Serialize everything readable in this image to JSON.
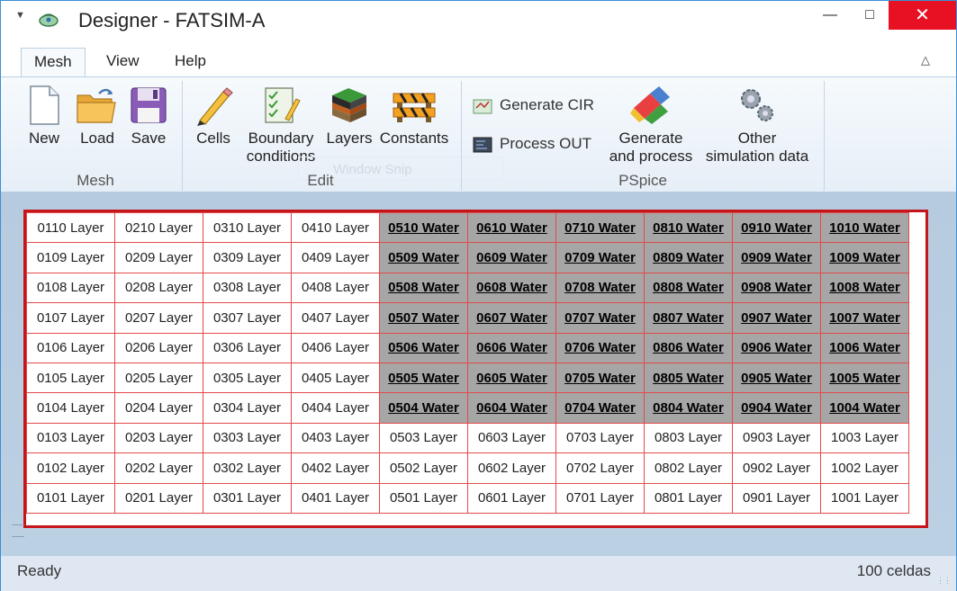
{
  "window": {
    "title": "Designer - FATSIM-A"
  },
  "tabs": [
    {
      "label": "Mesh",
      "active": true
    },
    {
      "label": "View",
      "active": false
    },
    {
      "label": "Help",
      "active": false
    }
  ],
  "ribbon": {
    "groups": {
      "mesh": "Mesh",
      "edit": "Edit",
      "pspice": "PSpice"
    },
    "buttons": {
      "new": "New",
      "load": "Load",
      "save": "Save",
      "cells": "Cells",
      "boundary_l1": "Boundary",
      "boundary_l2": "conditions",
      "layers": "Layers",
      "constants": "Constants",
      "generate_cir": "Generate CIR",
      "process_out": "Process OUT",
      "generate_l1": "Generate",
      "generate_l2": "and process",
      "other_l1": "Other",
      "other_l2": "simulation data"
    },
    "ghost_label": "Window Snip"
  },
  "mesh": {
    "rows": [
      [
        "0110 Layer",
        "0210 Layer",
        "0310 Layer",
        "0410 Layer",
        "0510 Water",
        "0610 Water",
        "0710 Water",
        "0810 Water",
        "0910 Water",
        "1010 Water"
      ],
      [
        "0109 Layer",
        "0209 Layer",
        "0309 Layer",
        "0409 Layer",
        "0509 Water",
        "0609 Water",
        "0709 Water",
        "0809 Water",
        "0909 Water",
        "1009 Water"
      ],
      [
        "0108 Layer",
        "0208 Layer",
        "0308 Layer",
        "0408 Layer",
        "0508 Water",
        "0608 Water",
        "0708 Water",
        "0808 Water",
        "0908 Water",
        "1008 Water"
      ],
      [
        "0107 Layer",
        "0207 Layer",
        "0307 Layer",
        "0407 Layer",
        "0507 Water",
        "0607 Water",
        "0707 Water",
        "0807 Water",
        "0907 Water",
        "1007 Water"
      ],
      [
        "0106 Layer",
        "0206 Layer",
        "0306 Layer",
        "0406 Layer",
        "0506 Water",
        "0606 Water",
        "0706 Water",
        "0806 Water",
        "0906 Water",
        "1006 Water"
      ],
      [
        "0105 Layer",
        "0205 Layer",
        "0305 Layer",
        "0405 Layer",
        "0505 Water",
        "0605 Water",
        "0705 Water",
        "0805 Water",
        "0905 Water",
        "1005 Water"
      ],
      [
        "0104 Layer",
        "0204 Layer",
        "0304 Layer",
        "0404 Layer",
        "0504 Water",
        "0604 Water",
        "0704 Water",
        "0804 Water",
        "0904 Water",
        "1004 Water"
      ],
      [
        "0103 Layer",
        "0203 Layer",
        "0303 Layer",
        "0403 Layer",
        "0503 Layer",
        "0603 Layer",
        "0703 Layer",
        "0803 Layer",
        "0903 Layer",
        "1003 Layer"
      ],
      [
        "0102 Layer",
        "0202 Layer",
        "0302 Layer",
        "0402 Layer",
        "0502 Layer",
        "0602 Layer",
        "0702 Layer",
        "0802 Layer",
        "0902 Layer",
        "1002 Layer"
      ],
      [
        "0101 Layer",
        "0201 Layer",
        "0301 Layer",
        "0401 Layer",
        "0501 Layer",
        "0601 Layer",
        "0701 Layer",
        "0801 Layer",
        "0901 Layer",
        "1001 Layer"
      ]
    ],
    "colors": {
      "water_fill": "#a6a6a6",
      "grid_line": "#e24a4a",
      "frame": "#c4151b"
    }
  },
  "status": {
    "left": "Ready",
    "right": "100 celdas"
  },
  "icons": [
    "menu-icon",
    "app-icon",
    "new-icon",
    "load-icon",
    "save-icon",
    "cells-icon",
    "boundary-icon",
    "layers-icon",
    "constants-icon",
    "generate-cir-icon",
    "process-out-icon",
    "generate-process-icon",
    "gears-icon"
  ]
}
